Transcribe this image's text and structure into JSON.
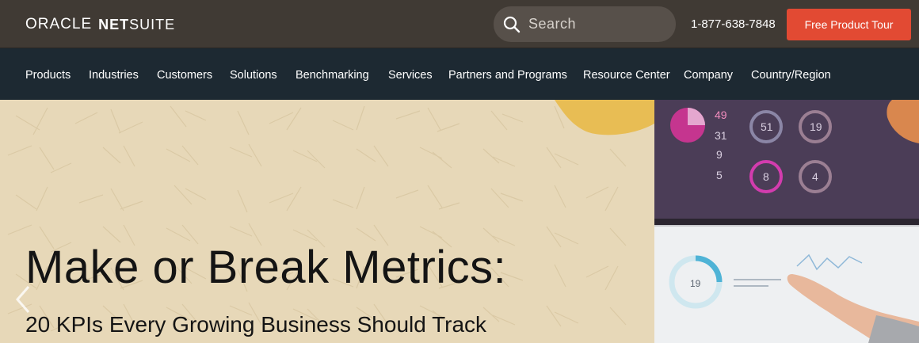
{
  "header": {
    "logo_oracle": "ORACLE",
    "logo_net": "NET",
    "logo_suite": "SUITE",
    "search_placeholder": "Search",
    "phone": "1-877-638-7848",
    "cta_label": "Free Product Tour"
  },
  "nav": {
    "items": [
      {
        "label": "Products"
      },
      {
        "label": "Industries"
      },
      {
        "label": "Customers"
      },
      {
        "label": "Solutions"
      },
      {
        "label": "Benchmarking"
      },
      {
        "label": "Services"
      },
      {
        "label": "Partners and Programs"
      },
      {
        "label": "Resource Center"
      },
      {
        "label": "Company"
      },
      {
        "label": "Country/Region"
      }
    ]
  },
  "hero": {
    "title": "Make or Break Metrics:",
    "subtitle": "20 KPIs Every Growing Business Should Track"
  },
  "dashboard": {
    "stats": [
      "49",
      "31",
      "9",
      "5"
    ],
    "rings": [
      "51",
      "19",
      "8",
      "4"
    ],
    "small_ring": "19"
  },
  "colors": {
    "topbar": "#403a34",
    "navbar": "#1d2932",
    "cta": "#e24a33",
    "hero_bg": "#e7d8b8",
    "search_bg": "#57504a"
  },
  "icons": {
    "search": "search-icon",
    "prev": "chevron-left-icon"
  }
}
